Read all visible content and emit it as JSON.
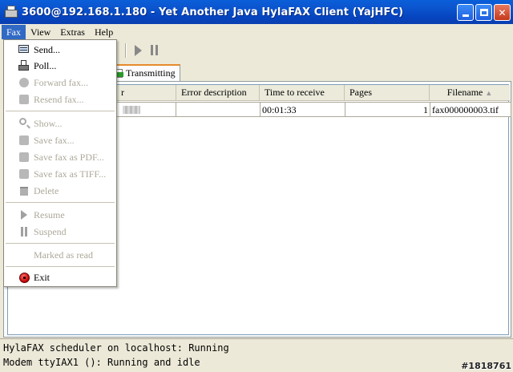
{
  "window": {
    "title": "3600@192.168.1.180 - Yet Another Java HylaFAX Client (YajHFC)",
    "minimize_glyph": "",
    "close_glyph": "✕"
  },
  "menubar": {
    "items": [
      {
        "label": "Fax"
      },
      {
        "label": "View"
      },
      {
        "label": "Extras"
      },
      {
        "label": "Help"
      }
    ]
  },
  "fax_menu": {
    "send": "Send...",
    "poll": "Poll...",
    "forward": "Forward fax...",
    "resend": "Resend fax...",
    "show": "Show...",
    "save_fax": "Save fax...",
    "save_pdf": "Save fax as PDF...",
    "save_tiff": "Save fax as TIFF...",
    "delete": "Delete",
    "resume": "Resume",
    "suspend": "Suspend",
    "marked_read": "Marked as read",
    "exit": "Exit"
  },
  "tabs": {
    "active": "Transmitting"
  },
  "table": {
    "columns": [
      {
        "label": "r"
      },
      {
        "label": "Error description"
      },
      {
        "label": "Time to receive"
      },
      {
        "label": "Pages"
      },
      {
        "label": "Filename",
        "sort": "▲"
      }
    ],
    "rows": [
      {
        "error": "",
        "time": "00:01:33",
        "pages": "1",
        "filename": "fax000000003.tif"
      }
    ]
  },
  "status": {
    "line1": "HylaFAX scheduler on localhost: Running",
    "line2": "Modem ttyIAX1 (): Running and idle"
  },
  "watermark": "#1818761"
}
